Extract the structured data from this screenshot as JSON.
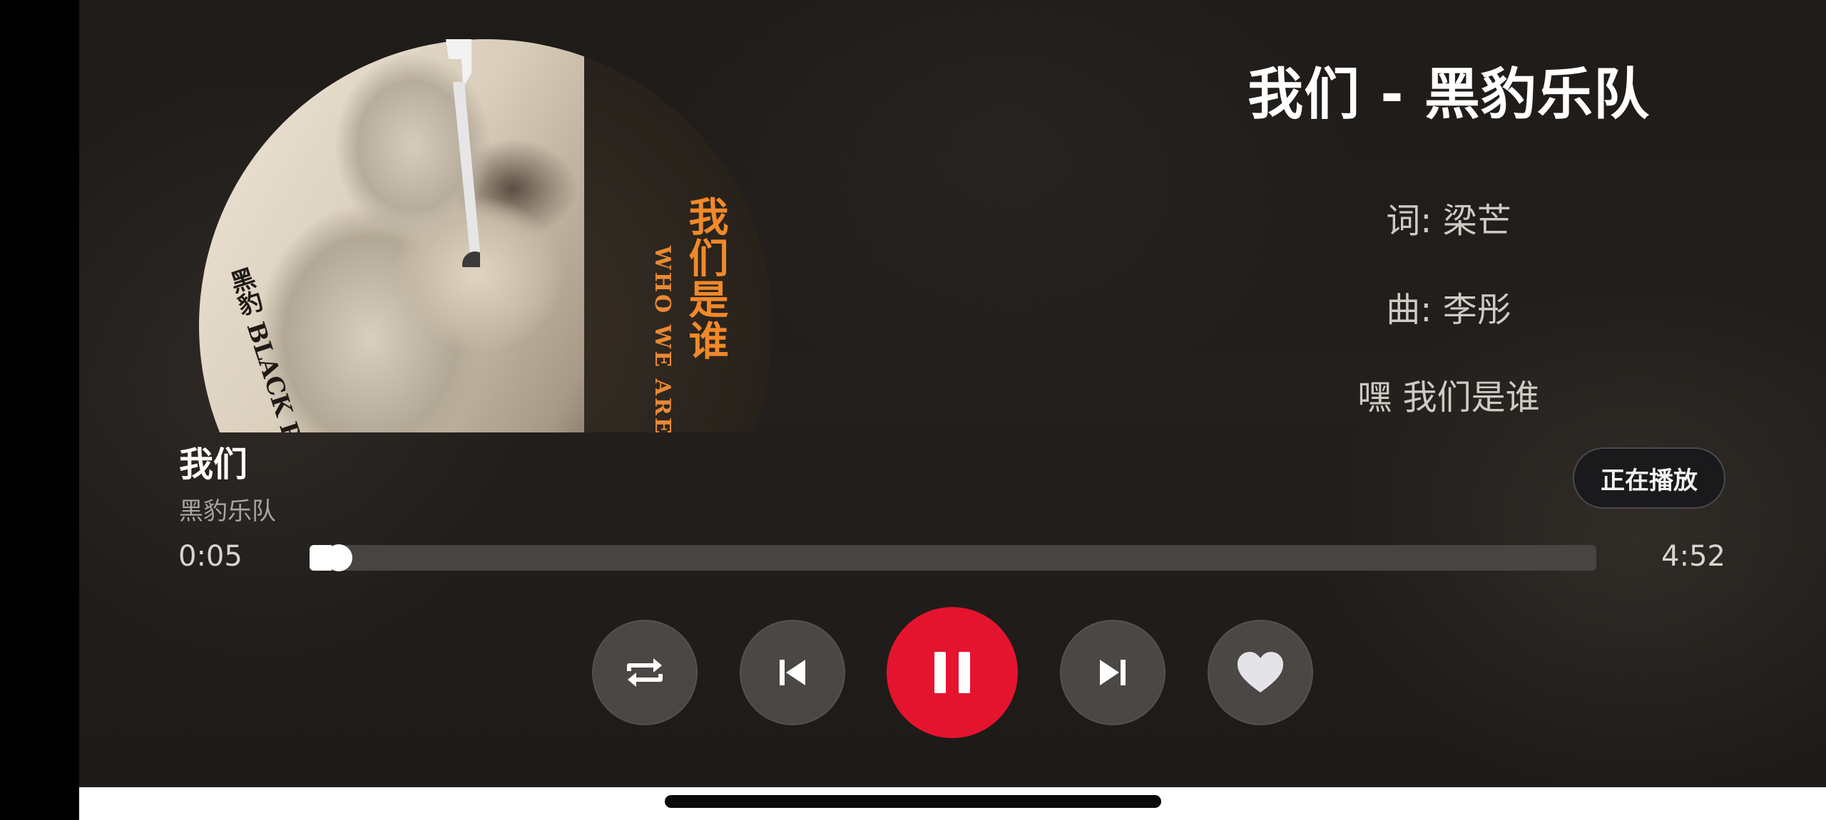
{
  "lyrics": {
    "song_heading": "我们 - 黑豹乐队",
    "lines": [
      "词: 梁芒",
      "曲: 李彤",
      "嘿 我们是谁"
    ]
  },
  "album_art": {
    "cover_title": "我们是谁",
    "cover_subtitle": "WHO WE ARE",
    "band_mark": "黑豹 BLACK PAN"
  },
  "track": {
    "title": "我们",
    "artist": "黑豹乐队"
  },
  "now_playing_label": "正在播放",
  "progress": {
    "current": "0:05",
    "total": "4:52",
    "fraction": 0.0171
  },
  "controls": {
    "repeat": "repeat-icon",
    "previous": "skip-previous-icon",
    "play_pause": "pause-icon",
    "next": "skip-next-icon",
    "like": "heart-icon"
  },
  "colors": {
    "accent_red": "#e5142e",
    "cover_orange": "#f0892a"
  }
}
